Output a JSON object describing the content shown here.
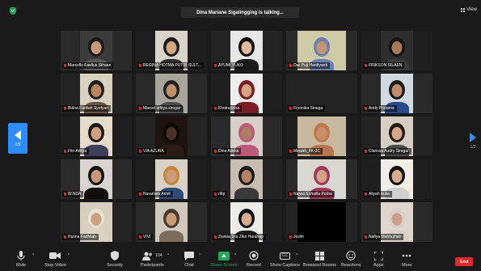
{
  "header": {
    "talking": "Dina Mariane Sigalingging is talking...",
    "view_label": "View"
  },
  "pagination": {
    "left": "1/3",
    "right": "1/3"
  },
  "participants": [
    {
      "name": "Marcello Faelius Sihaan",
      "video": true,
      "bg": "#3b3b3b",
      "skin": "#c99a7a",
      "hair": "#1a1a1a",
      "top": "#5a5a5a"
    },
    {
      "name": "REGINA HOTMA PUTRI SULT...",
      "video": true,
      "bg": "#d8d4cc",
      "skin": "#d6a582",
      "hair": "#1c1c1c",
      "top": "#2e2e2e"
    },
    {
      "name": "AYUMI YUKO",
      "video": true,
      "bg": "#e6e6e6",
      "skin": "#e2b79a",
      "hair": "#0e0e0e",
      "top": "#1b1b1b"
    },
    {
      "name": "Dwi Puji Hardiyanti",
      "video": true,
      "bg": "#cfcaa6",
      "skin": "#c69572",
      "hair": "#6c7fb0",
      "top": "#6c7fb0"
    },
    {
      "name": "FRIKSON SILAEN",
      "video": true,
      "bg": "#2e2e2e",
      "skin": "#a87758",
      "hair": "#151515",
      "top": "#3a3a3a"
    },
    {
      "name": "Bulna Fadilah Syofyan",
      "video": true,
      "bg": "#d9d2c0",
      "skin": "#b8855f",
      "hair": "#1e1e1e",
      "top": "#6b5446"
    },
    {
      "name": "Marcel aditya siregar",
      "video": true,
      "bg": "#a8a69a",
      "skin": "#c38f6b",
      "hair": "#222",
      "top": "#4d4d4d"
    },
    {
      "name": "Khoirunnisa",
      "video": true,
      "bg": "#eeeeee",
      "skin": "#d4a485",
      "hair": "#7a1d24",
      "top": "#7a1d24"
    },
    {
      "name": "Fryonika Sinaga",
      "video": false
    },
    {
      "name": "Andy Pratama",
      "video": true,
      "bg": "#d0d8e0",
      "skin": "#c18d68",
      "hair": "#1a1a1a",
      "top": "#294a8a"
    },
    {
      "name": "Fitri Adilya",
      "video": true,
      "bg": "#e4dcc8",
      "skin": "#d0a080",
      "hair": "#1b1b1b",
      "top": "#3e3e5c"
    },
    {
      "name": "VIA AZURA",
      "video": true,
      "bg": "#1d1410",
      "skin": "#4a3225",
      "hair": "#0e0a08",
      "top": "#2b1c15"
    },
    {
      "name": "Dina Adelia",
      "video": true,
      "bg": "#d8d0c8",
      "skin": "#b07f62",
      "hair": "#b85c7a",
      "top": "#b85c7a"
    },
    {
      "name": "Mewah_4K-3C",
      "video": true,
      "bg": "#c9b8a0",
      "skin": "#c6906a",
      "hair": "#c07a4a",
      "top": "#b3764f"
    },
    {
      "name": "Clarissa Audry Siregar",
      "video": true,
      "bg": "#d5cfc3",
      "skin": "#d4a889",
      "hair": "#241a14",
      "top": "#4c4c4c"
    },
    {
      "name": "W.NDA",
      "video": true,
      "bg": "#d9d4cf",
      "skin": "#c9987a",
      "hair": "#111",
      "top": "#111"
    },
    {
      "name": "Nuranisia Amril",
      "video": true,
      "bg": "#d7d2c5",
      "skin": "#cd9c7c",
      "hair": "#c8863c",
      "top": "#2f4b7a"
    },
    {
      "name": "rifqi",
      "video": true,
      "bg": "#c7bdb3",
      "skin": "#b78262",
      "hair": "#1a1a1a",
      "top": "#3a3a3a"
    },
    {
      "name": "Najwa Suhailla Purba",
      "video": true,
      "bg": "#dad7d2",
      "skin": "#d2a384",
      "hair": "#a3385a",
      "top": "#a3385a"
    },
    {
      "name": "Aliyah Aulia",
      "video": true,
      "bg": "#f0ece6",
      "skin": "#d8ab8c",
      "hair": "#101010",
      "top": "#d0d0d0"
    },
    {
      "name": "Husna Fadhilah",
      "video": true,
      "bg": "#d8cfc0",
      "skin": "#caa07e",
      "hair": "#e8e0d2",
      "top": "#d9d2c4"
    },
    {
      "name": "VIVI",
      "video": true,
      "bg": "#cfc8bd",
      "skin": "#c99a78",
      "hair": "#4a3a30",
      "top": "#7d6c5c"
    },
    {
      "name": "Zaskia Tria Zikri Harahap",
      "video": true,
      "bg": "#ecebe8",
      "skin": "#d8ab8f",
      "hair": "#0f0f0f",
      "top": "#1c1c1c"
    },
    {
      "name": "Jeslin",
      "video": true,
      "bg": "#000000",
      "skin": "#000000",
      "hair": "#000000",
      "top": "#000000"
    },
    {
      "name": "Nafiya Mahfuzhah",
      "video": true,
      "bg": "#dcd6ce",
      "skin": "#c8a08a",
      "hair": "#d8d0c6",
      "top": "#d8d0c6"
    }
  ],
  "toolbar": {
    "mute": "Mute",
    "stop_video": "Stop Video",
    "security": "Security",
    "participants": "Participants",
    "participant_count": "104",
    "chat": "Chat",
    "share_screen": "Share Screen",
    "record": "Record",
    "show_captions": "Show Captions",
    "breakout_rooms": "Breakout Rooms",
    "reactions": "Reactions",
    "apps": "Apps",
    "more": "More",
    "end": "End",
    "cc": "CC"
  },
  "colors": {
    "accent": "#2d8cff",
    "share": "#23a55a",
    "end": "#e02828",
    "muted": "#e02828"
  }
}
